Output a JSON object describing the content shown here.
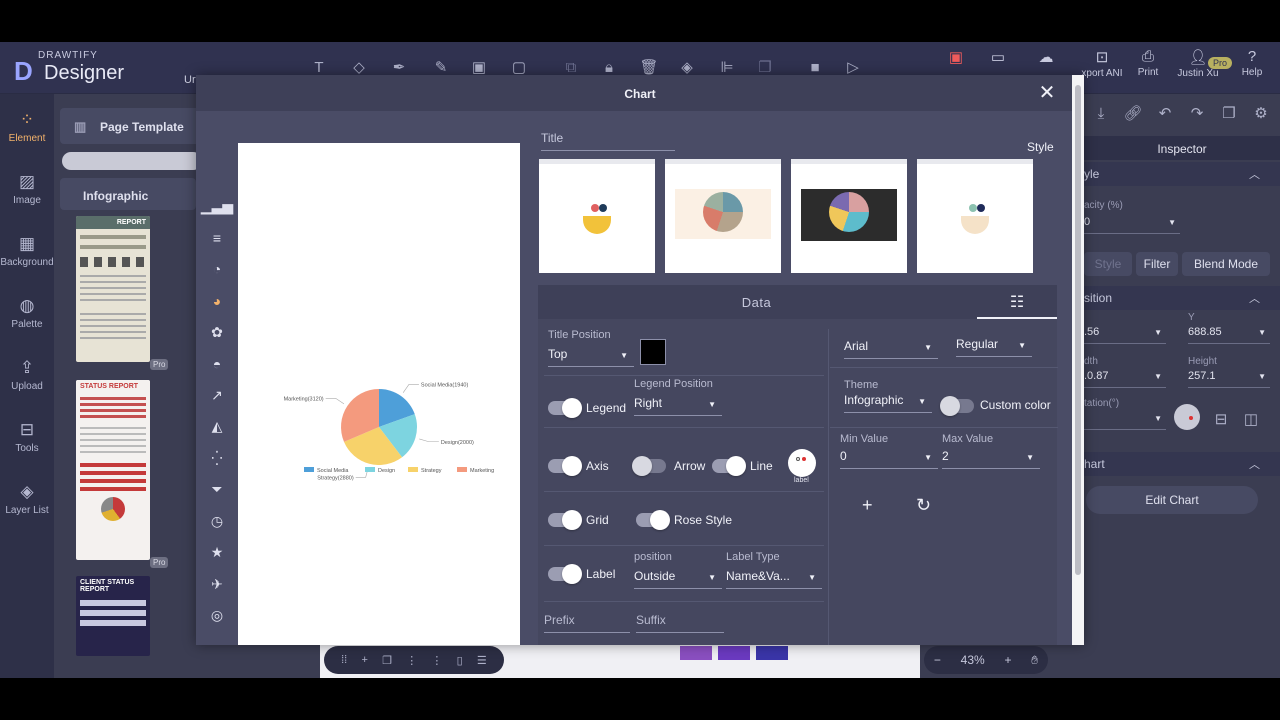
{
  "app": {
    "brand": "DRAWTIFY",
    "name": "Designer",
    "doc_prefix": "Ur"
  },
  "topbar": {
    "tools": [
      "text-icon",
      "shapes-icon",
      "pen-tool-icon",
      "pencil-icon",
      "image-icon",
      "frame-icon",
      "group-icon",
      "lock-icon",
      "trash-icon",
      "layers-icon",
      "align-icon",
      "duplicate-icon",
      "video-icon",
      "play-icon"
    ],
    "right": [
      {
        "label": "",
        "icon": "save-icon"
      },
      {
        "label": "",
        "icon": "present-icon"
      },
      {
        "label": "",
        "icon": "cloud-icon"
      },
      {
        "label": "xport ANI",
        "icon": "export-ani-icon"
      },
      {
        "label": "Print",
        "icon": "print-icon"
      },
      {
        "label": "Justin Xu",
        "icon": "user-icon"
      },
      {
        "label": "Help",
        "icon": "help-icon"
      }
    ],
    "pro_badge": "Pro"
  },
  "rail": [
    {
      "label": "Element",
      "icon": "element-icon",
      "active": true
    },
    {
      "label": "Image",
      "icon": "image-icon"
    },
    {
      "label": "Background",
      "icon": "background-icon"
    },
    {
      "label": "Palette",
      "icon": "palette-icon"
    },
    {
      "label": "Upload",
      "icon": "upload-icon"
    },
    {
      "label": "Tools",
      "icon": "tools-icon"
    },
    {
      "label": "Layer List",
      "icon": "layers-icon"
    }
  ],
  "template_panel": {
    "page_template": "Page Template",
    "category": "Infographic",
    "thumbs": [
      {
        "title": "REPORT",
        "pro": "Pro"
      },
      {
        "title": "STATUS REPORT",
        "pro": "Pro"
      },
      {
        "title": "CLIENT STATUS REPORT",
        "pro": ""
      }
    ]
  },
  "modal": {
    "title": "Chart",
    "title_placeholder": "Title",
    "style_label": "Style",
    "tab_data": "Data",
    "form": {
      "title_position_label": "Title Position",
      "title_position": "Top",
      "title_color": "#000000",
      "legend_label": "Legend",
      "legend_position_label": "Legend Position",
      "legend_position": "Right",
      "axis_label": "Axis",
      "arrow_label": "Arrow",
      "line_label": "Line",
      "label_badge": "label",
      "grid_label": "Grid",
      "rose_label": "Rose Style",
      "label_label": "Label",
      "position_label": "position",
      "position_value": "Outside",
      "label_type_label": "Label Type",
      "label_type_value": "Name&Va...",
      "prefix_label": "Prefix",
      "suffix_label": "Suffix",
      "font_family": "Arial",
      "font_weight": "Regular",
      "theme_label": "Theme",
      "theme_value": "Infographic",
      "custom_color_label": "Custom color",
      "min_label": "Min Value",
      "min_value": "0",
      "max_label": "Max Value",
      "max_value": "2"
    }
  },
  "inspector": {
    "title": "Inspector",
    "style_sec": "yle",
    "opacity_label": "acity (%)",
    "opacity_value": "0",
    "btn_style": "Style",
    "btn_filter": "Filter",
    "btn_blend": "Blend Mode",
    "position_sec": "sition",
    "x_value": ".56",
    "y_label": "Y",
    "y_value": "688.85",
    "width_label": "dth",
    "width_value": ".0.87",
    "height_label": "Height",
    "height_value": "257.1",
    "rotation_label": "tation(°)",
    "chart_sec": "hart",
    "edit_chart": "Edit Chart"
  },
  "bottom": {
    "zoom": "43%"
  },
  "chart_data": {
    "type": "pie",
    "categories": [
      "Social Media",
      "Design",
      "Strategy",
      "Marketing"
    ],
    "values": [
      1940,
      2000,
      2880,
      3120
    ],
    "labels": [
      "Social Media(1940)",
      "Design(2000)",
      "Strategy(2880)",
      "Marketing(3120)"
    ],
    "colors": [
      "#4e9fd9",
      "#7dd4e0",
      "#f7d26a",
      "#f49a7e"
    ],
    "legend": "bottom"
  }
}
